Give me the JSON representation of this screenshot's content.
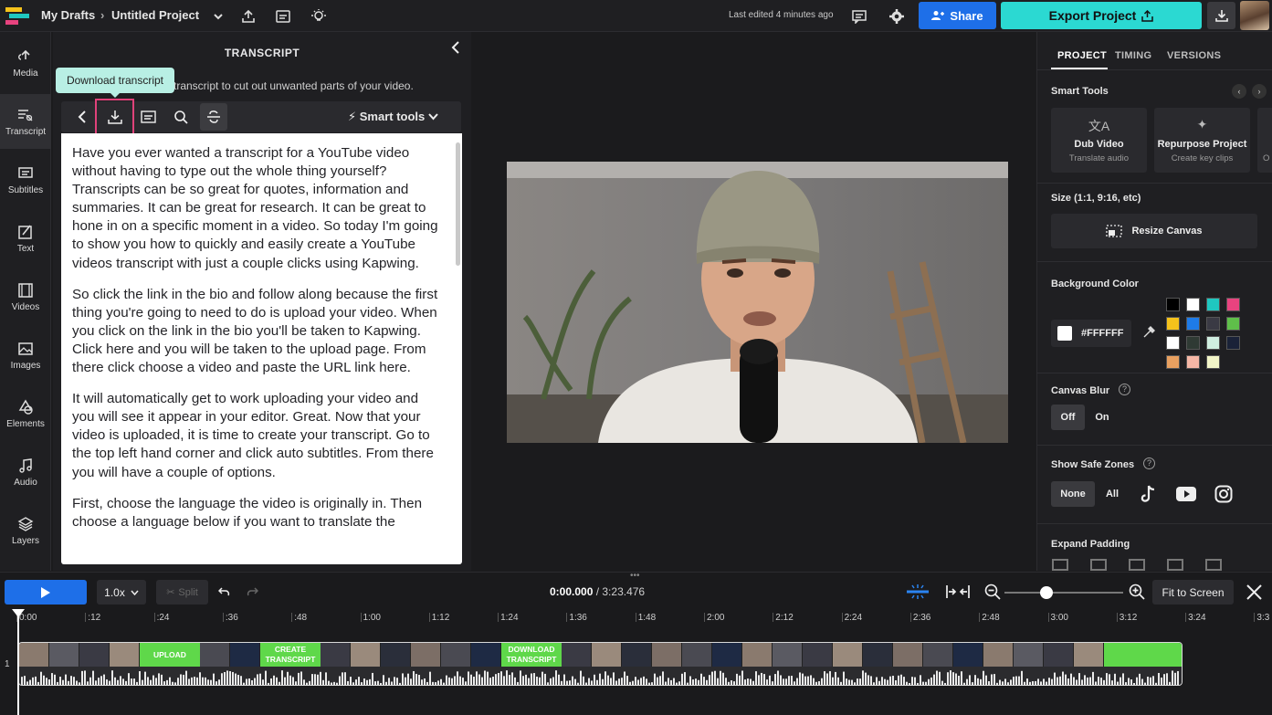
{
  "topbar": {
    "breadcrumb_root": "My Drafts",
    "project_name": "Untitled Project",
    "last_edited": "Last edited 4 minutes ago",
    "share_label": "Share",
    "export_label": "Export Project"
  },
  "leftnav": {
    "items": [
      {
        "label": "Media",
        "icon": "upload-icon"
      },
      {
        "label": "Transcript",
        "icon": "transcript-icon"
      },
      {
        "label": "Subtitles",
        "icon": "subtitles-icon"
      },
      {
        "label": "Text",
        "icon": "text-icon"
      },
      {
        "label": "Videos",
        "icon": "film-icon"
      },
      {
        "label": "Images",
        "icon": "image-icon"
      },
      {
        "label": "Elements",
        "icon": "shapes-icon"
      },
      {
        "label": "Audio",
        "icon": "music-icon"
      },
      {
        "label": "Layers",
        "icon": "layers-icon"
      }
    ]
  },
  "transcript": {
    "title": "TRANSCRIPT",
    "description": "transcript to cut out unwanted parts of your video.",
    "tooltip": "Download transcript",
    "smart_tools_label": "Smart tools",
    "paragraphs": [
      "Have you ever wanted a transcript for a YouTube video without having to type out the whole thing yourself? Transcripts can be so great for quotes, information and summaries. It can be great for research. It can be great to hone in on a specific moment in a video. So today I'm going to show you how to quickly and easily create a YouTube videos transcript with just a couple clicks using Kapwing.",
      "So click the link in the bio and follow along because the first thing you're going to need to do is upload your video. When you click on the link in the bio you'll be taken to Kapwing. Click here and you will be taken to the upload page. From there click choose a video and paste the URL link here.",
      "It will automatically get to work uploading your video and you will see it appear in your editor. Great. Now that your video is uploaded, it is time to create your transcript. Go to the top left hand corner and click auto subtitles. From there you will have a couple of options.",
      "First, choose the language the video is originally in. Then choose a language below if you want to translate the"
    ]
  },
  "rightpanel": {
    "tabs": [
      "PROJECT",
      "TIMING",
      "VERSIONS"
    ],
    "smart_tools_title": "Smart Tools",
    "tool_cards": [
      {
        "title": "Dub Video",
        "subtitle": "Translate audio",
        "icon": "translate-icon"
      },
      {
        "title": "Repurpose Project",
        "subtitle": "Create key clips",
        "icon": "sparkle-icon"
      },
      {
        "title": "",
        "subtitle": "O",
        "icon": ""
      }
    ],
    "size_title": "Size (1:1, 9:16, etc)",
    "resize_label": "Resize Canvas",
    "bg_color_title": "Background Color",
    "bg_color_value": "#FFFFFF",
    "swatches": [
      "#000000",
      "#ffffff",
      "#1fc7c0",
      "#e8437f",
      "#f5c21b",
      "#1e7be8",
      "#3a3a44",
      "#5fbf4a",
      "#ffffff",
      "#2f3a34",
      "#cfeee0",
      "#1a2238",
      "#e8a060",
      "#f5b7a6",
      "#f2f5c8"
    ],
    "canvas_blur_title": "Canvas Blur",
    "blur_off": "Off",
    "blur_on": "On",
    "safe_zones_title": "Show Safe Zones",
    "safe_none": "None",
    "safe_all": "All",
    "expand_padding_title": "Expand Padding"
  },
  "timeline": {
    "speed": "1.0x",
    "split_label": "Split",
    "current_time": "0:00.000",
    "total_time": "/ 3:23.476",
    "fit_label": "Fit to Screen",
    "ticks": [
      "0:00",
      ":12",
      ":24",
      ":36",
      ":48",
      "1:00",
      "1:12",
      "1:24",
      "1:36",
      "1:48",
      "2:00",
      "2:12",
      "2:24",
      "2:36",
      "2:48",
      "3:00",
      "3:12",
      "3:24",
      "3:3"
    ],
    "track_number": "1",
    "clip_labels": [
      "UPLOAD",
      "CREATE TRANSCRIPT",
      "DOWNLOAD TRANSCRIPT"
    ]
  }
}
